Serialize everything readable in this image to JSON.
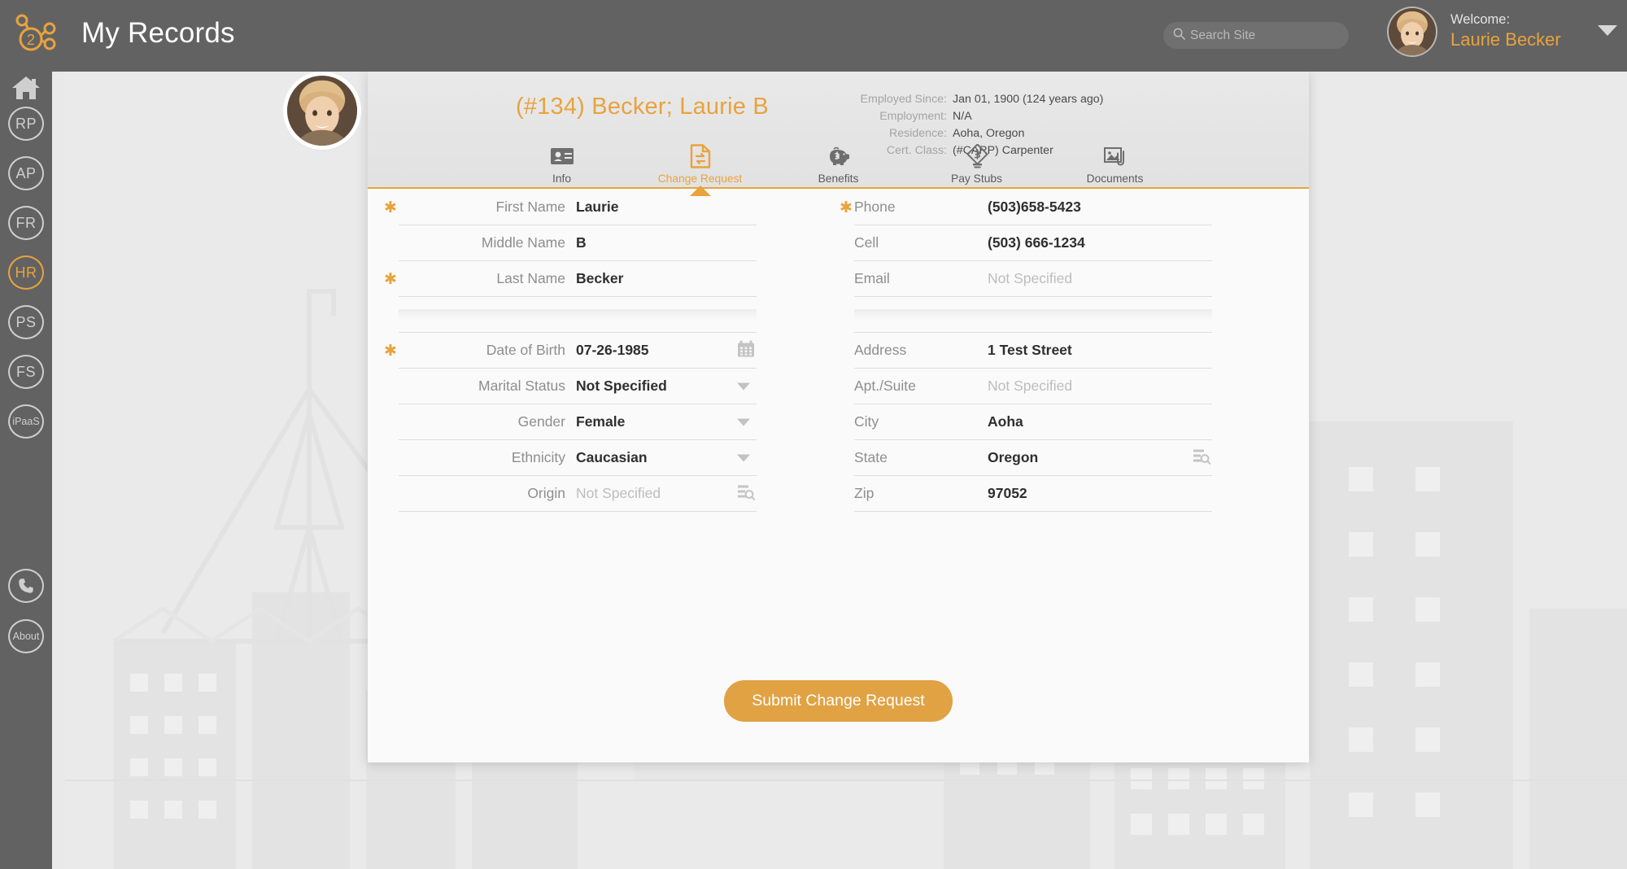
{
  "app": {
    "title": "My Records",
    "logo_icon": "connected-nodes-2-logo"
  },
  "search": {
    "placeholder": "Search Site",
    "value": "",
    "icon": "search-icon"
  },
  "user_menu": {
    "welcome_label": "Welcome:",
    "user_name": "Laurie Becker",
    "caret_icon": "chevron-down-icon",
    "avatar_icon": "user-avatar"
  },
  "colors": {
    "accent": "#e8a33d",
    "topbar": "#626262",
    "card": "#fafafa",
    "label": "#8e8e8e",
    "value": "#2f2f2f",
    "placeholder": "#bdbdbd"
  },
  "rail": {
    "items": [
      {
        "label": "",
        "icon": "home-icon",
        "active": false,
        "name": "sidebar-item-home"
      },
      {
        "label": "RP",
        "icon": "oval-badge",
        "active": false,
        "name": "sidebar-item-rp"
      },
      {
        "label": "AP",
        "icon": "oval-badge",
        "active": false,
        "name": "sidebar-item-ap"
      },
      {
        "label": "FR",
        "icon": "oval-badge",
        "active": false,
        "name": "sidebar-item-fr"
      },
      {
        "label": "HR",
        "icon": "oval-badge",
        "active": true,
        "name": "sidebar-item-hr"
      },
      {
        "label": "PS",
        "icon": "oval-badge",
        "active": false,
        "name": "sidebar-item-ps"
      },
      {
        "label": "FS",
        "icon": "oval-badge",
        "active": false,
        "name": "sidebar-item-fs"
      },
      {
        "label": "iPaaS",
        "icon": "oval-badge",
        "active": false,
        "name": "sidebar-item-ipaas"
      }
    ],
    "bottom": [
      {
        "label": "",
        "icon": "phone-icon",
        "name": "sidebar-item-contact"
      },
      {
        "label": "About",
        "icon": "oval-badge",
        "name": "sidebar-item-about"
      }
    ]
  },
  "record": {
    "title": "(#134) Becker; Laurie B",
    "avatar_icon": "record-avatar",
    "meta": [
      {
        "label": "Employed Since:",
        "value": "Jan 01, 1900 (124 years ago)"
      },
      {
        "label": "Employment:",
        "value": "N/A"
      },
      {
        "label": "Residence:",
        "value": "Aoha, Oregon"
      },
      {
        "label": "Cert. Class:",
        "value": "(#CARP) Carpenter"
      }
    ]
  },
  "tabs": [
    {
      "label": "Info",
      "icon": "id-card-icon",
      "active": false
    },
    {
      "label": "Change Request",
      "icon": "change-request-icon",
      "active": true
    },
    {
      "label": "Benefits",
      "icon": "piggy-bank-icon",
      "active": false
    },
    {
      "label": "Pay Stubs",
      "icon": "pay-stub-icon",
      "active": false
    },
    {
      "label": "Documents",
      "icon": "document-clip-icon",
      "active": false
    }
  ],
  "form": {
    "left": [
      {
        "label": "First Name",
        "value": "Laurie",
        "required": true,
        "empty": false,
        "control": "text",
        "icon": ""
      },
      {
        "label": "Middle Name",
        "value": "B",
        "required": false,
        "empty": false,
        "control": "text",
        "icon": ""
      },
      {
        "label": "Last Name",
        "value": "Becker",
        "required": true,
        "empty": false,
        "control": "text",
        "icon": ""
      },
      {
        "label": "",
        "value": "",
        "required": false,
        "empty": true,
        "control": "spacer",
        "icon": ""
      },
      {
        "label": "Date of Birth",
        "value": "07-26-1985",
        "required": true,
        "empty": false,
        "control": "date",
        "icon": "calendar-icon"
      },
      {
        "label": "Marital Status",
        "value": "Not Specified",
        "required": false,
        "empty": false,
        "control": "select",
        "icon": "chevron-down-icon"
      },
      {
        "label": "Gender",
        "value": "Female",
        "required": false,
        "empty": false,
        "control": "select",
        "icon": "chevron-down-icon"
      },
      {
        "label": "Ethnicity",
        "value": "Caucasian",
        "required": false,
        "empty": false,
        "control": "select",
        "icon": "chevron-down-icon"
      },
      {
        "label": "Origin",
        "value": "Not Specified",
        "required": false,
        "empty": true,
        "control": "lookup",
        "icon": "list-search-icon"
      }
    ],
    "right": [
      {
        "label": "Phone",
        "value": "(503)658-5423",
        "required": true,
        "empty": false,
        "control": "text",
        "icon": ""
      },
      {
        "label": "Cell",
        "value": "(503) 666-1234",
        "required": false,
        "empty": false,
        "control": "text",
        "icon": ""
      },
      {
        "label": "Email",
        "value": "Not Specified",
        "required": false,
        "empty": true,
        "control": "text",
        "icon": ""
      },
      {
        "label": "",
        "value": "",
        "required": false,
        "empty": true,
        "control": "spacer",
        "icon": ""
      },
      {
        "label": "Address",
        "value": "1 Test Street",
        "required": false,
        "empty": false,
        "control": "text",
        "icon": ""
      },
      {
        "label": "Apt./Suite",
        "value": "Not Specified",
        "required": false,
        "empty": true,
        "control": "text",
        "icon": ""
      },
      {
        "label": "City",
        "value": "Aoha",
        "required": false,
        "empty": false,
        "control": "text",
        "icon": ""
      },
      {
        "label": "State",
        "value": "Oregon",
        "required": false,
        "empty": false,
        "control": "lookup",
        "icon": "list-search-icon"
      },
      {
        "label": "Zip",
        "value": "97052",
        "required": false,
        "empty": false,
        "control": "text",
        "icon": ""
      }
    ],
    "submit_label": "Submit Change Request"
  }
}
